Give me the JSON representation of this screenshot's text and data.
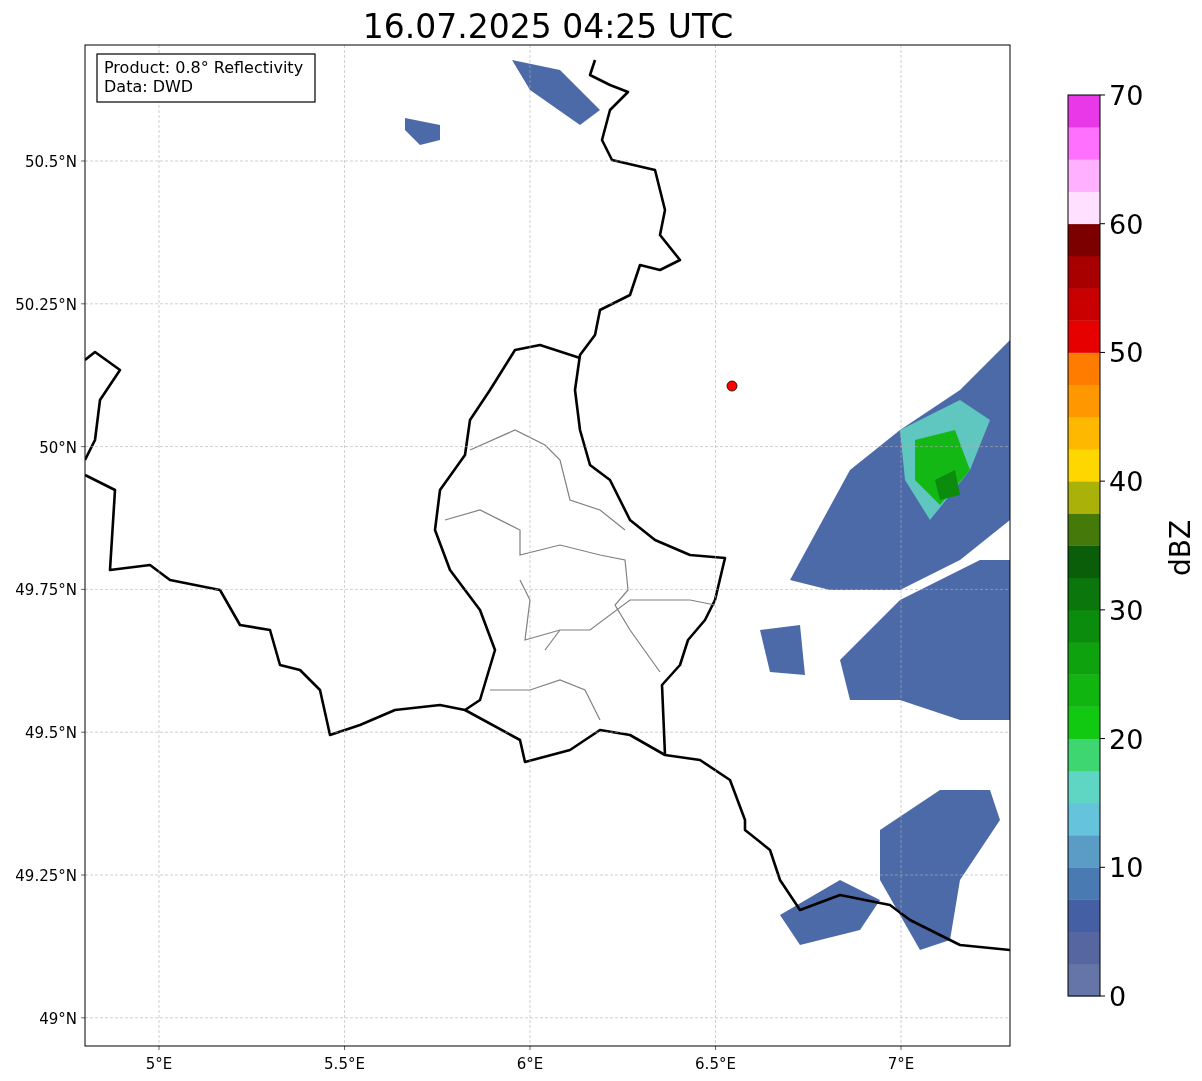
{
  "title": "16.07.2025 04:25 UTC",
  "map": {
    "legend": [
      "Product: 0.8° Reflectivity",
      "Data: DWD"
    ],
    "yticks": [
      "50.5°N",
      "50.25°N",
      "50°N",
      "49.75°N",
      "49.5°N",
      "49.25°N",
      "49°N"
    ],
    "xticks": [
      "5°E",
      "5.5°E",
      "6°E",
      "6.5°E",
      "7°E"
    ]
  },
  "colorbar": {
    "label": "dBZ",
    "ticks": [
      "70",
      "60",
      "50",
      "40",
      "30",
      "20",
      "10",
      "0"
    ],
    "segments": [
      {
        "color": "#6675a8"
      },
      {
        "color": "#5666a0"
      },
      {
        "color": "#445fa4"
      },
      {
        "color": "#4a7ab2"
      },
      {
        "color": "#5a9cc6"
      },
      {
        "color": "#66c3dc"
      },
      {
        "color": "#5fd5c4"
      },
      {
        "color": "#3dd671"
      },
      {
        "color": "#12c912"
      },
      {
        "color": "#10b510"
      },
      {
        "color": "#0ea20e"
      },
      {
        "color": "#0c8c0c"
      },
      {
        "color": "#0b760b"
      },
      {
        "color": "#0a5e0a"
      },
      {
        "color": "#457a0a"
      },
      {
        "color": "#aab20a"
      },
      {
        "color": "#ffd700"
      },
      {
        "color": "#ffb800"
      },
      {
        "color": "#ff9800"
      },
      {
        "color": "#ff7c00"
      },
      {
        "color": "#e60000"
      },
      {
        "color": "#c80000"
      },
      {
        "color": "#a80000"
      },
      {
        "color": "#7d0000"
      },
      {
        "color": "#ffe0ff"
      },
      {
        "color": "#ffb0ff"
      },
      {
        "color": "#ff70ff"
      },
      {
        "color": "#e838e8"
      }
    ]
  }
}
